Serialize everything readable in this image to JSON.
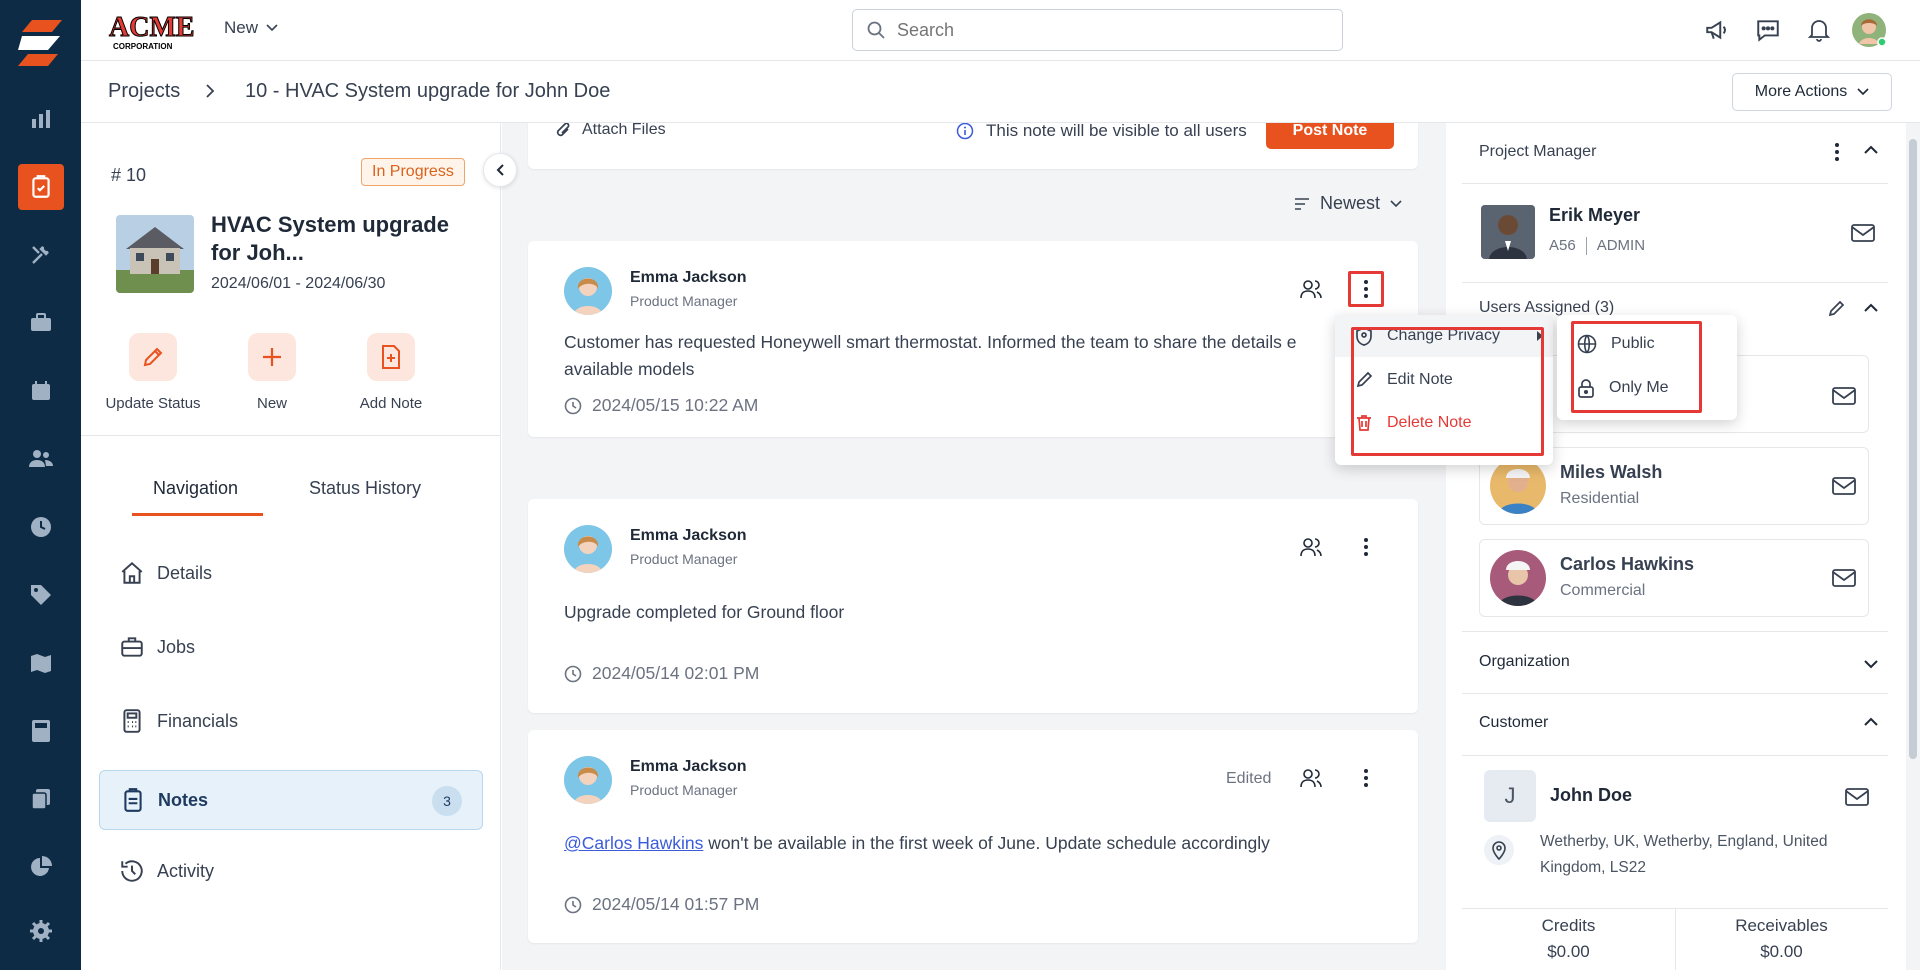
{
  "app": {
    "brand_logo_text": "ACME CORPORATION",
    "new_menu_label": "New",
    "search_placeholder": "Search"
  },
  "breadcrumb": {
    "root": "Projects",
    "current": "10 - HVAC System upgrade for John Doe",
    "more_actions": "More Actions"
  },
  "project": {
    "number": "# 10",
    "status": "In Progress",
    "title": "HVAC System upgrade for Joh...",
    "dates": "2024/06/01 - 2024/06/30",
    "actions": [
      "Update Status",
      "New",
      "Add Note"
    ],
    "tabs": [
      "Navigation",
      "Status History"
    ],
    "nav": [
      {
        "label": "Details",
        "icon": "home-icon"
      },
      {
        "label": "Jobs",
        "icon": "briefcase-icon"
      },
      {
        "label": "Financials",
        "icon": "calculator-icon"
      },
      {
        "label": "Notes",
        "icon": "clipboard-icon",
        "badge": "3"
      },
      {
        "label": "Activity",
        "icon": "history-icon"
      }
    ]
  },
  "composer": {
    "attach": "Attach Files",
    "visibility": "This note will be visible to all users",
    "post": "Post Note"
  },
  "sort": {
    "label": "Newest"
  },
  "notes": [
    {
      "author": "Emma Jackson",
      "role": "Product Manager",
      "text": "Customer has requested Honeywell smart thermostat. Informed the team to share the details e available models",
      "timestamp": "2024/05/15 10:22 AM"
    },
    {
      "author": "Emma Jackson",
      "role": "Product Manager",
      "text": "Upgrade completed for Ground floor",
      "timestamp": "2024/05/14 02:01 PM"
    },
    {
      "author": "Emma Jackson",
      "role": "Product Manager",
      "edited": "Edited",
      "mention": "@Carlos Hawkins",
      "text": " won't be available in the first week of June. Update schedule accordingly",
      "timestamp": "2024/05/14 01:57 PM"
    }
  ],
  "note_menu": {
    "change_privacy": "Change Privacy",
    "edit": "Edit Note",
    "delete": "Delete Note"
  },
  "privacy_menu": {
    "public": "Public",
    "only_me": "Only Me"
  },
  "right": {
    "pm_header": "Project Manager",
    "pm_name": "Erik Meyer",
    "pm_code": "A56",
    "pm_role": "ADMIN",
    "users_header": "Users Assigned (3)",
    "users": [
      {
        "name": "",
        "sub": ""
      },
      {
        "name": "Miles Walsh",
        "sub": "Residential"
      },
      {
        "name": "Carlos Hawkins",
        "sub": "Commercial"
      }
    ],
    "org_header": "Organization",
    "customer_header": "Customer",
    "customer_initial": "J",
    "customer_name": "John Doe",
    "customer_address": "Wetherby, UK, Wetherby, England, United Kingdom, LS22",
    "credits_label": "Credits",
    "credits_value": "$0.00",
    "receivables_label": "Receivables",
    "receivables_value": "$0.00"
  },
  "colors": {
    "rail": "#0e2b45",
    "accent": "#e8521e",
    "highlight": "#e53935",
    "status_bg": "#fff4ea"
  }
}
